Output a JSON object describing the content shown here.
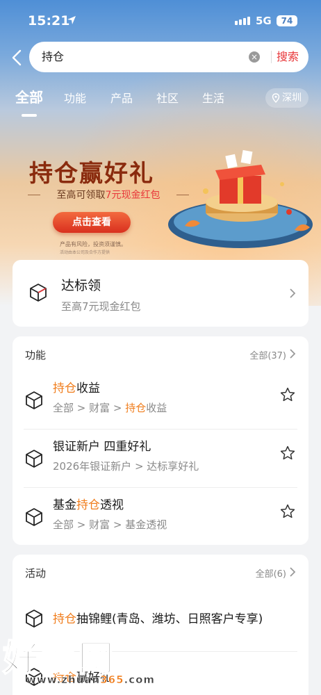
{
  "status": {
    "time": "15:21",
    "network": "5G",
    "battery": "74"
  },
  "search": {
    "value": "持仓",
    "button": "搜索"
  },
  "tabs": [
    {
      "label": "全部",
      "active": true
    },
    {
      "label": "功能"
    },
    {
      "label": "产品"
    },
    {
      "label": "社区"
    },
    {
      "label": "生活"
    }
  ],
  "location": "深圳",
  "banner": {
    "title": "持仓赢好礼",
    "subtitle_pre": "至高可领取",
    "subtitle_hl": "7元现金红包",
    "cta": "点击查看",
    "note": "产品有风险，投资须谨慎。",
    "note2": "活动由本公司及合作方提供",
    "accent": "#e8373a"
  },
  "reward_card": {
    "title": "达标领",
    "desc": "至高7元现金红包",
    "icon": "cube-icon"
  },
  "functions": {
    "title": "功能",
    "all_label": "全部(37)",
    "items": [
      {
        "title_hl": "持仓",
        "title_rest": "收益",
        "path_pre": "全部 > 财富 > ",
        "path_hl": "持仓",
        "path_post": "收益"
      },
      {
        "title_pre": "银证新户 四重好礼",
        "path": "2026年银证新户 > 达标享好礼"
      },
      {
        "title_pre": "基金",
        "title_hl": "持仓",
        "title_rest": "透视",
        "path": "全部 > 财富 > 基金透视"
      }
    ]
  },
  "activities": {
    "title": "活动",
    "all_label": "全部(6)",
    "items": [
      {
        "title_hl": "持仓",
        "title_rest": "抽锦鲤(青岛、潍坊、日照客户专享)"
      },
      {
        "title_hl": "持仓",
        "title_rest": "赢好礼"
      }
    ]
  },
  "watermark": {
    "text": "好赚网",
    "url_pre": "www.zhuan",
    "url_hl": "365",
    "url_post": ".com"
  },
  "colors": {
    "orange_highlight": "#f07d1c",
    "search_red": "#e8373a"
  }
}
